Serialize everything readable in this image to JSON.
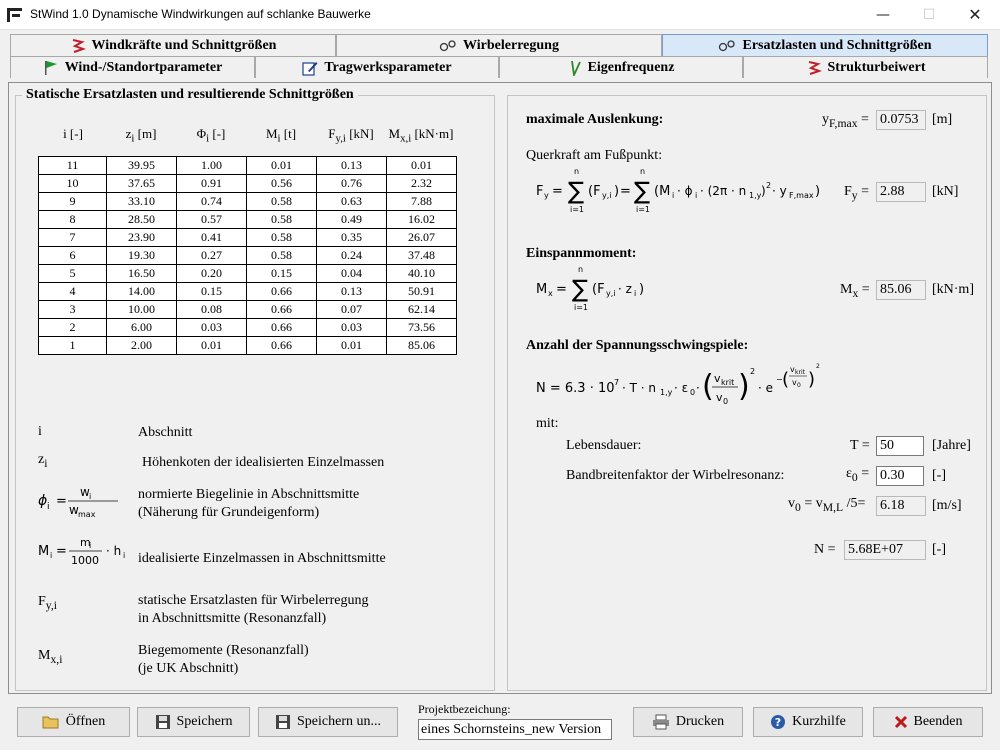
{
  "window": {
    "title": "StWind 1.0   Dynamische Windwirkungen auf schlanke Bauwerke",
    "minimize": "—",
    "maximize": "☐",
    "close": "✕"
  },
  "tabs_row1": [
    {
      "label": "Windkräfte und Schnittgrößen",
      "icon": "zigzag-icon"
    },
    {
      "label": "Wirbelerregung",
      "icon": "vortex-icon"
    },
    {
      "label": "Ersatzlasten und Schnittgrößen",
      "icon": "vortex-icon",
      "active": true
    }
  ],
  "tabs_row2": [
    {
      "label": "Wind-/Standortparameter",
      "icon": "flag-icon"
    },
    {
      "label": "Tragwerksparameter",
      "icon": "edit-icon"
    },
    {
      "label": "Eigenfrequenz",
      "icon": "frequency-icon"
    },
    {
      "label": "Strukturbeiwert",
      "icon": "zigzag-icon"
    }
  ],
  "left": {
    "group_title": "Statische Ersatzlasten und resultierende Schnittgrößen",
    "columns": [
      "i [-]",
      "z",
      "Φ",
      "M",
      "F",
      "M"
    ],
    "column_subs": [
      "",
      "i",
      "i",
      "i",
      "y,i",
      "x,i"
    ],
    "column_units": [
      "",
      " [m]",
      " [-]",
      " [t]",
      " [kN]",
      " [kN·m]"
    ],
    "rows": [
      [
        "11",
        "39.95",
        "1.00",
        "0.01",
        "0.13",
        "0.01"
      ],
      [
        "10",
        "37.65",
        "0.91",
        "0.56",
        "0.76",
        "2.32"
      ],
      [
        "9",
        "33.10",
        "0.74",
        "0.58",
        "0.63",
        "7.88"
      ],
      [
        "8",
        "28.50",
        "0.57",
        "0.58",
        "0.49",
        "16.02"
      ],
      [
        "7",
        "23.90",
        "0.41",
        "0.58",
        "0.35",
        "26.07"
      ],
      [
        "6",
        "19.30",
        "0.27",
        "0.58",
        "0.24",
        "37.48"
      ],
      [
        "5",
        "16.50",
        "0.20",
        "0.15",
        "0.04",
        "40.10"
      ],
      [
        "4",
        "14.00",
        "0.15",
        "0.66",
        "0.13",
        "50.91"
      ],
      [
        "3",
        "10.00",
        "0.08",
        "0.66",
        "0.07",
        "62.14"
      ],
      [
        "2",
        "6.00",
        "0.03",
        "0.66",
        "0.03",
        "73.56"
      ],
      [
        "1",
        "2.00",
        "0.01",
        "0.66",
        "0.01",
        "85.06"
      ]
    ],
    "legend": {
      "i_sym": "i",
      "i_text": "Abschnitt",
      "z_sym": "z",
      "z_sub": "i",
      "z_text": "Höhenkoten der idealisierten Einzelmassen",
      "phi_text1": "normierte Biegelinie in Abschnittsmitte",
      "phi_text2": "(Näherung für Grundeigenform)",
      "m_text": "idealisierte Einzelmassen in Abschnittsmitte",
      "fy_sym": "F",
      "fy_sub": "y,i",
      "fy_text1": "statische Ersatzlasten für Wirbelerregung",
      "fy_text2": "in Abschnittsmitte (Resonanzfall)",
      "mx_sym": "M",
      "mx_sub": "x,i",
      "mx_text1": "Biegemomente (Resonanzfall)",
      "mx_text2": "(je UK Abschnitt)"
    }
  },
  "right": {
    "max_label": "maximale Auslenkung:",
    "yf_sym": "y",
    "yf_sub": "F,max",
    "yf_value": "0.0753",
    "yf_unit": "[m]",
    "querkraft_label": "Querkraft am Fußpunkt:",
    "fy_sym": "F",
    "fy_sub": "y",
    "fy_value": "2.88",
    "fy_unit": "[kN]",
    "einspann_label": "Einspannmoment:",
    "mx_sym": "M",
    "mx_sub": "x",
    "mx_value": "85.06",
    "mx_unit": "[kN·m]",
    "anzahl_label": "Anzahl der Spannungsschwingspiele:",
    "mit_label": "mit:",
    "lebensdauer_label": "Lebensdauer:",
    "t_sym": "T",
    "t_value": "50",
    "t_unit": "[Jahre]",
    "bandbreite_label": "Bandbreitenfaktor der Wirbelresonanz:",
    "eps_sym": "ε",
    "eps_sub": "0",
    "eps_value": "0.30",
    "eps_unit": "[-]",
    "v0_sym": "v",
    "v0_sub": "0",
    "v0_rhs": "= v",
    "v0_rhs_sub": "M,L",
    "v0_tail": " /5=",
    "v0_value": "6.18",
    "v0_unit": "[m/s]",
    "n_sym": "N =",
    "n_value": "5.68E+07",
    "n_unit": "[-]"
  },
  "footer": {
    "open": "Öffnen",
    "save": "Speichern",
    "save_as": "Speichern un...",
    "project_label": "Projektbezeichung:",
    "project_value": "eines Schornsteins_new Version",
    "print": "Drucken",
    "help": "Kurzhilfe",
    "exit": "Beenden"
  }
}
